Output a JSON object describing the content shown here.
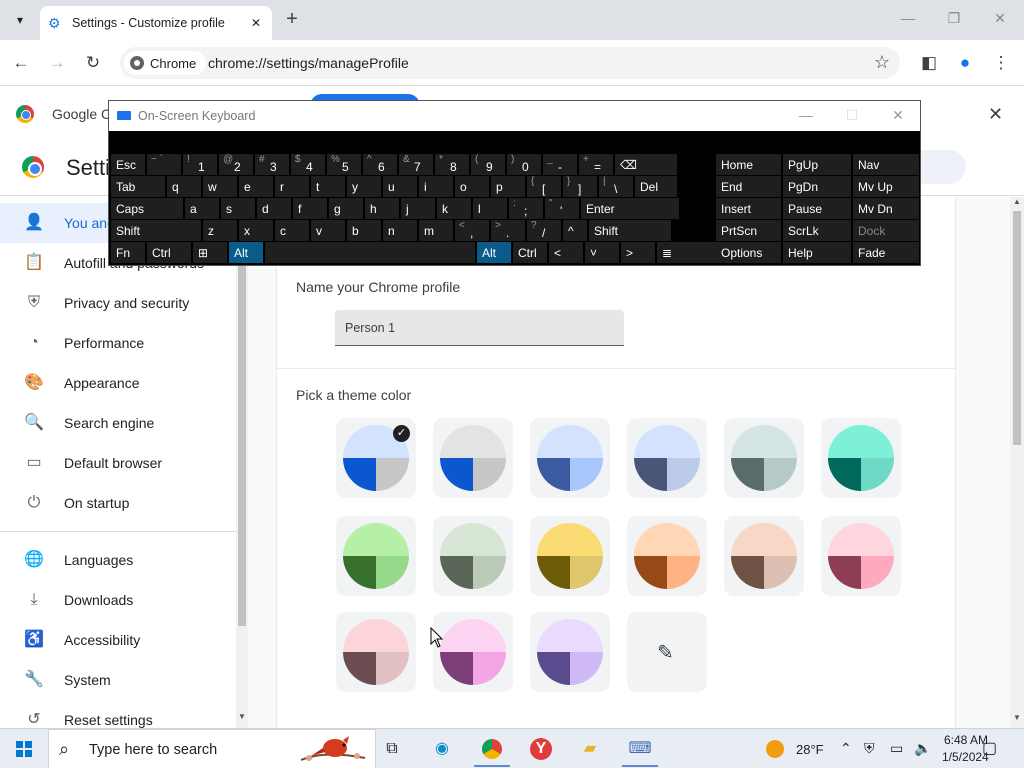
{
  "browser": {
    "tab_title": "Settings - Customize profile",
    "new_tab": "+",
    "tab_close": "✕",
    "url": "chrome://settings/manageProfile",
    "site_chip": "Chrome"
  },
  "infobar": {
    "text": "Google Cl"
  },
  "settings": {
    "title": "Setti",
    "sidebar": [
      {
        "label": "You and Google",
        "icon": "person-icon",
        "glyph": "👤"
      },
      {
        "label": "Autofill and passwords",
        "icon": "clipboard-icon",
        "glyph": "📋"
      },
      {
        "label": "Privacy and security",
        "icon": "shield-icon",
        "glyph": "⛨"
      },
      {
        "label": "Performance",
        "icon": "gauge-icon",
        "glyph": "◔"
      },
      {
        "label": "Appearance",
        "icon": "palette-icon",
        "glyph": "🎨"
      },
      {
        "label": "Search engine",
        "icon": "search-icon",
        "glyph": "🔍"
      },
      {
        "label": "Default browser",
        "icon": "browser-icon",
        "glyph": "▭"
      },
      {
        "label": "On startup",
        "icon": "power-icon",
        "glyph": "⏻"
      },
      {
        "label": "Languages",
        "icon": "globe-icon",
        "glyph": "🌐"
      },
      {
        "label": "Downloads",
        "icon": "download-icon",
        "glyph": "⤓"
      },
      {
        "label": "Accessibility",
        "icon": "accessibility-icon",
        "glyph": "♿"
      },
      {
        "label": "System",
        "icon": "wrench-icon",
        "glyph": "🔧"
      },
      {
        "label": "Reset settings",
        "icon": "reset-icon",
        "glyph": "↺"
      }
    ],
    "name_section_label": "Name your Chrome profile",
    "name_value": "Person 1",
    "theme_section_label": "Pick a theme color",
    "themes": [
      {
        "top": "#d3e3fd",
        "left": "#0b57d0",
        "right": "#c7c7c7",
        "selected": true
      },
      {
        "top": "#e3e3e3",
        "left": "#0b57d0",
        "right": "#c7c7c7",
        "selected": false
      },
      {
        "top": "#d3e3fd",
        "left": "#3a5ba0",
        "right": "#a8c7fa",
        "selected": false
      },
      {
        "top": "#d3e3fd",
        "left": "#4a5578",
        "right": "#bccbe9",
        "selected": false
      },
      {
        "top": "#d5e5e5",
        "left": "#5a6b6b",
        "right": "#b5c9c9",
        "selected": false
      },
      {
        "top": "#7ff0d8",
        "left": "#00695c",
        "right": "#6fd8c6",
        "selected": false
      },
      {
        "top": "#b6f0a6",
        "left": "#37702d",
        "right": "#96d98a",
        "selected": false
      },
      {
        "top": "#d7e6d4",
        "left": "#5a6658",
        "right": "#bccab8",
        "selected": false
      },
      {
        "top": "#fbdc74",
        "left": "#6c5b07",
        "right": "#e0c66a",
        "selected": false
      },
      {
        "top": "#ffd6b6",
        "left": "#964a16",
        "right": "#ffb384",
        "selected": false
      },
      {
        "top": "#f8d7c6",
        "left": "#6e5244",
        "right": "#dbbfb0",
        "selected": false
      },
      {
        "top": "#ffd5de",
        "left": "#8e3e54",
        "right": "#ffa9bd",
        "selected": false
      },
      {
        "top": "#fdd5d9",
        "left": "#6b4d51",
        "right": "#e1c0c4",
        "selected": false
      },
      {
        "top": "#fcd4f2",
        "left": "#7b3e78",
        "right": "#f3a5e5",
        "selected": false
      },
      {
        "top": "#e8dbfd",
        "left": "#5a4a8e",
        "right": "#cfb9f6",
        "selected": false
      }
    ],
    "picker_icon": "eyedropper-icon"
  },
  "osk": {
    "title": "On-Screen Keyboard",
    "rows": [
      [
        {
          "l": "Esc",
          "w": 36
        },
        {
          "s": "~ `",
          "l": "",
          "w": 36
        },
        {
          "s": "!",
          "l": "1",
          "w": 36
        },
        {
          "s": "@",
          "l": "2",
          "w": 36
        },
        {
          "s": "#",
          "l": "3",
          "w": 36
        },
        {
          "s": "$",
          "l": "4",
          "w": 36
        },
        {
          "s": "%",
          "l": "5",
          "w": 36
        },
        {
          "s": "^",
          "l": "6",
          "w": 36
        },
        {
          "s": "&",
          "l": "7",
          "w": 36
        },
        {
          "s": "*",
          "l": "8",
          "w": 36
        },
        {
          "s": "(",
          "l": "9",
          "w": 36
        },
        {
          "s": ")",
          "l": "0",
          "w": 36
        },
        {
          "s": "_",
          "l": "-",
          "w": 36
        },
        {
          "s": "+",
          "l": "=",
          "w": 36
        },
        {
          "l": "⌫",
          "w": 64
        }
      ],
      [
        {
          "l": "Tab",
          "w": 56
        },
        {
          "l": "q",
          "w": 36
        },
        {
          "l": "w",
          "w": 36
        },
        {
          "l": "e",
          "w": 36
        },
        {
          "l": "r",
          "w": 36
        },
        {
          "l": "t",
          "w": 36
        },
        {
          "l": "y",
          "w": 36
        },
        {
          "l": "u",
          "w": 36
        },
        {
          "l": "i",
          "w": 36
        },
        {
          "l": "o",
          "w": 36
        },
        {
          "l": "p",
          "w": 36
        },
        {
          "s": "{",
          "l": "[",
          "w": 36
        },
        {
          "s": "}",
          "l": "]",
          "w": 36
        },
        {
          "s": "|",
          "l": "\\",
          "w": 36
        },
        {
          "l": "Del",
          "w": 44
        }
      ],
      [
        {
          "l": "Caps",
          "w": 74
        },
        {
          "l": "a",
          "w": 36
        },
        {
          "l": "s",
          "w": 36
        },
        {
          "l": "d",
          "w": 36
        },
        {
          "l": "f",
          "w": 36
        },
        {
          "l": "g",
          "w": 36
        },
        {
          "l": "h",
          "w": 36
        },
        {
          "l": "j",
          "w": 36
        },
        {
          "l": "k",
          "w": 36
        },
        {
          "l": "l",
          "w": 36
        },
        {
          "s": ":",
          "l": ";",
          "w": 36
        },
        {
          "s": "\"",
          "l": "'",
          "w": 36
        },
        {
          "l": "Enter",
          "w": 100
        }
      ],
      [
        {
          "l": "Shift",
          "w": 92
        },
        {
          "l": "z",
          "w": 36
        },
        {
          "l": "x",
          "w": 36
        },
        {
          "l": "c",
          "w": 36
        },
        {
          "l": "v",
          "w": 36
        },
        {
          "l": "b",
          "w": 36
        },
        {
          "l": "n",
          "w": 36
        },
        {
          "l": "m",
          "w": 36
        },
        {
          "s": "<",
          "l": ",",
          "w": 36
        },
        {
          "s": ">",
          "l": ".",
          "w": 36
        },
        {
          "s": "?",
          "l": "/",
          "w": 36
        },
        {
          "l": "^",
          "w": 26
        },
        {
          "l": "Shift",
          "w": 84
        }
      ],
      [
        {
          "l": "Fn",
          "w": 36
        },
        {
          "l": "Ctrl",
          "w": 46
        },
        {
          "l": "⊞",
          "w": 36
        },
        {
          "l": "Alt",
          "w": 36,
          "hl": true
        },
        {
          "l": "",
          "w": 212
        },
        {
          "l": "Alt",
          "w": 36,
          "hl": true
        },
        {
          "l": "Ctrl",
          "w": 36
        },
        {
          "l": "<",
          "w": 36
        },
        {
          "l": "˅",
          "w": 36
        },
        {
          "l": ">",
          "w": 36
        },
        {
          "l": "≣",
          "w": 64
        }
      ]
    ],
    "nav_keys": [
      [
        "Home",
        "PgUp",
        "Nav"
      ],
      [
        "End",
        "PgDn",
        "Mv Up"
      ],
      [
        "Insert",
        "Pause",
        "Mv Dn"
      ],
      [
        "PrtScn",
        "ScrLk",
        "Dock"
      ],
      [
        "Options",
        "Help",
        "Fade"
      ]
    ]
  },
  "taskbar": {
    "search_placeholder": "Type here to search",
    "weather": "28°F",
    "time": "6:48 AM",
    "date": "1/5/2024"
  }
}
